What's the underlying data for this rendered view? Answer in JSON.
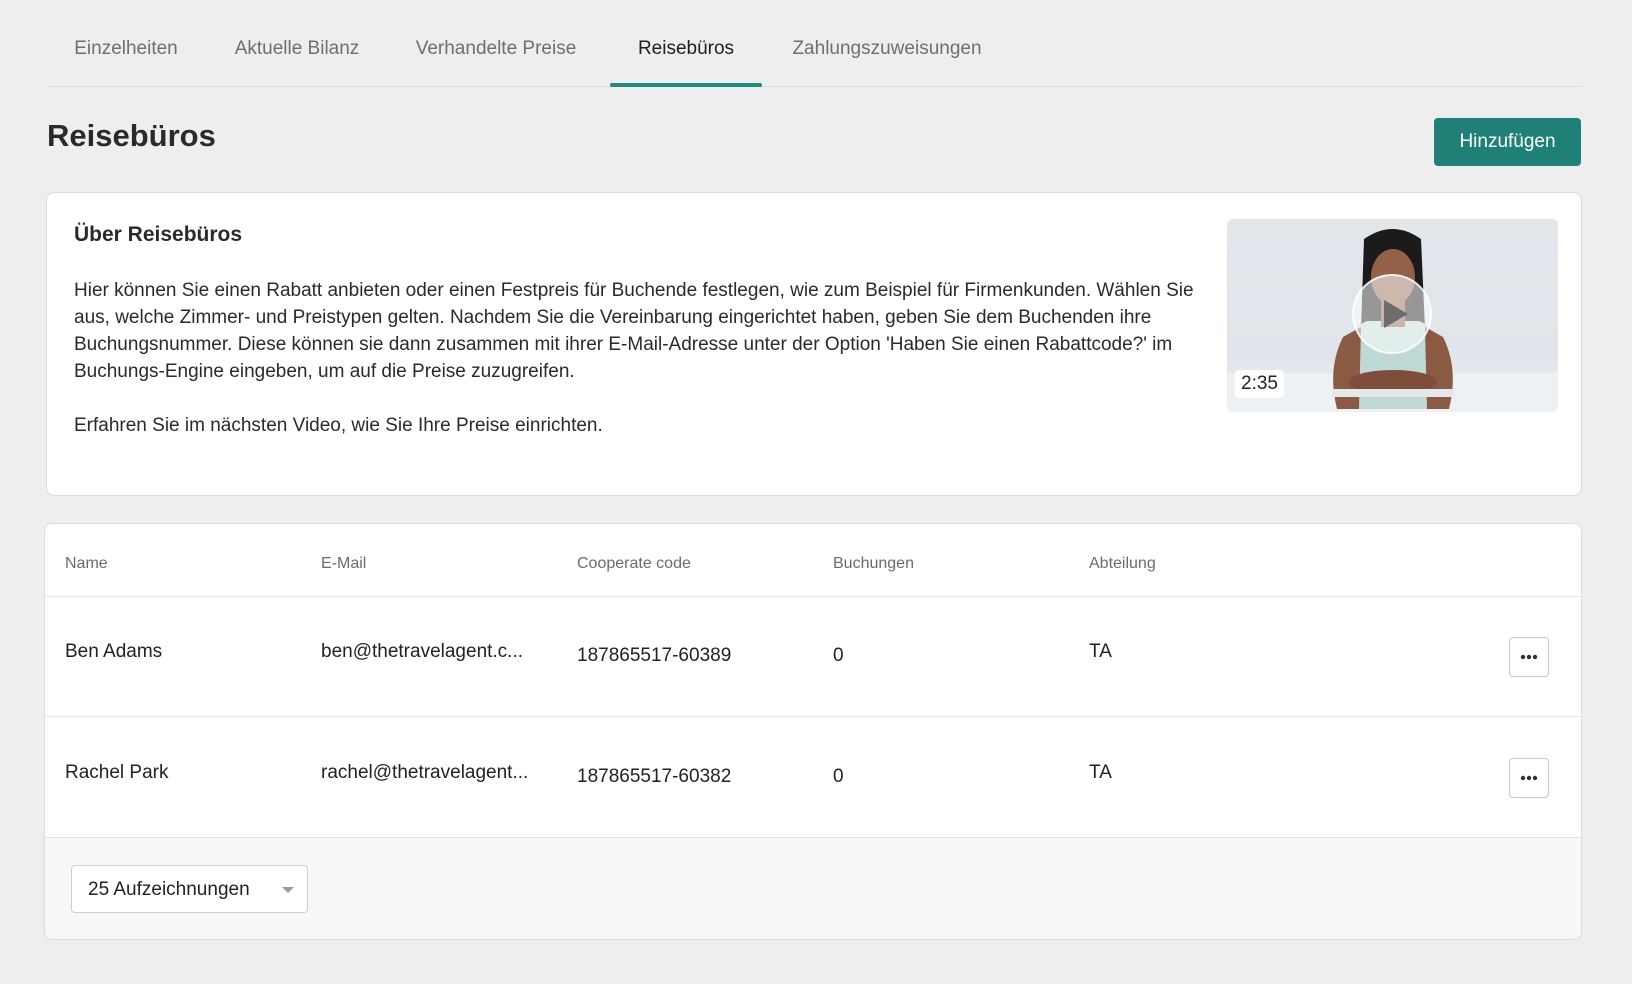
{
  "tabs": [
    {
      "label": "Einzelheiten",
      "active": false
    },
    {
      "label": "Aktuelle Bilanz",
      "active": false
    },
    {
      "label": "Verhandelte Preise",
      "active": false
    },
    {
      "label": "Reisebüros",
      "active": true
    },
    {
      "label": "Zahlungszuweisungen",
      "active": false
    }
  ],
  "header": {
    "title": "Reisebüros",
    "add_label": "Hinzufügen"
  },
  "info": {
    "title": "Über Reisebüros",
    "paragraph1": "Hier können Sie einen Rabatt anbieten oder einen Festpreis für Buchende festlegen, wie zum Beispiel für Firmenkunden. Wählen Sie aus, welche Zimmer- und Preistypen gelten. Nachdem Sie die Vereinbarung eingerichtet haben, geben Sie dem Buchenden ihre Buchungsnummer. Diese können sie dann zusammen mit ihrer E-Mail-Adresse unter der Option 'Haben Sie einen Rabattcode?' im Buchungs-Engine eingeben, um auf die Preise zuzugreifen.",
    "paragraph2": "Erfahren Sie im nächsten Video, wie Sie Ihre Preise einrichten.",
    "video_duration": "2:35",
    "play_icon": "play-icon"
  },
  "table": {
    "columns": [
      "Name",
      "E-Mail",
      "Cooperate code",
      "Buchungen",
      "Abteilung"
    ],
    "rows": [
      {
        "name": "Ben Adams",
        "email": "ben@thetravelagent.c...",
        "code": "187865517-60389",
        "bookings": "0",
        "department": "TA"
      },
      {
        "name": "Rachel Park",
        "email": "rachel@thetravelagent...",
        "code": "187865517-60382",
        "bookings": "0",
        "department": "TA"
      }
    ],
    "row_action_icon": "more-horizontal-icon"
  },
  "pagination": {
    "page_size_label": "25 Aufzeichnungen"
  },
  "colors": {
    "accent": "#1f8077",
    "tab_underline": "#1f8a80",
    "background": "#eeeeee"
  }
}
